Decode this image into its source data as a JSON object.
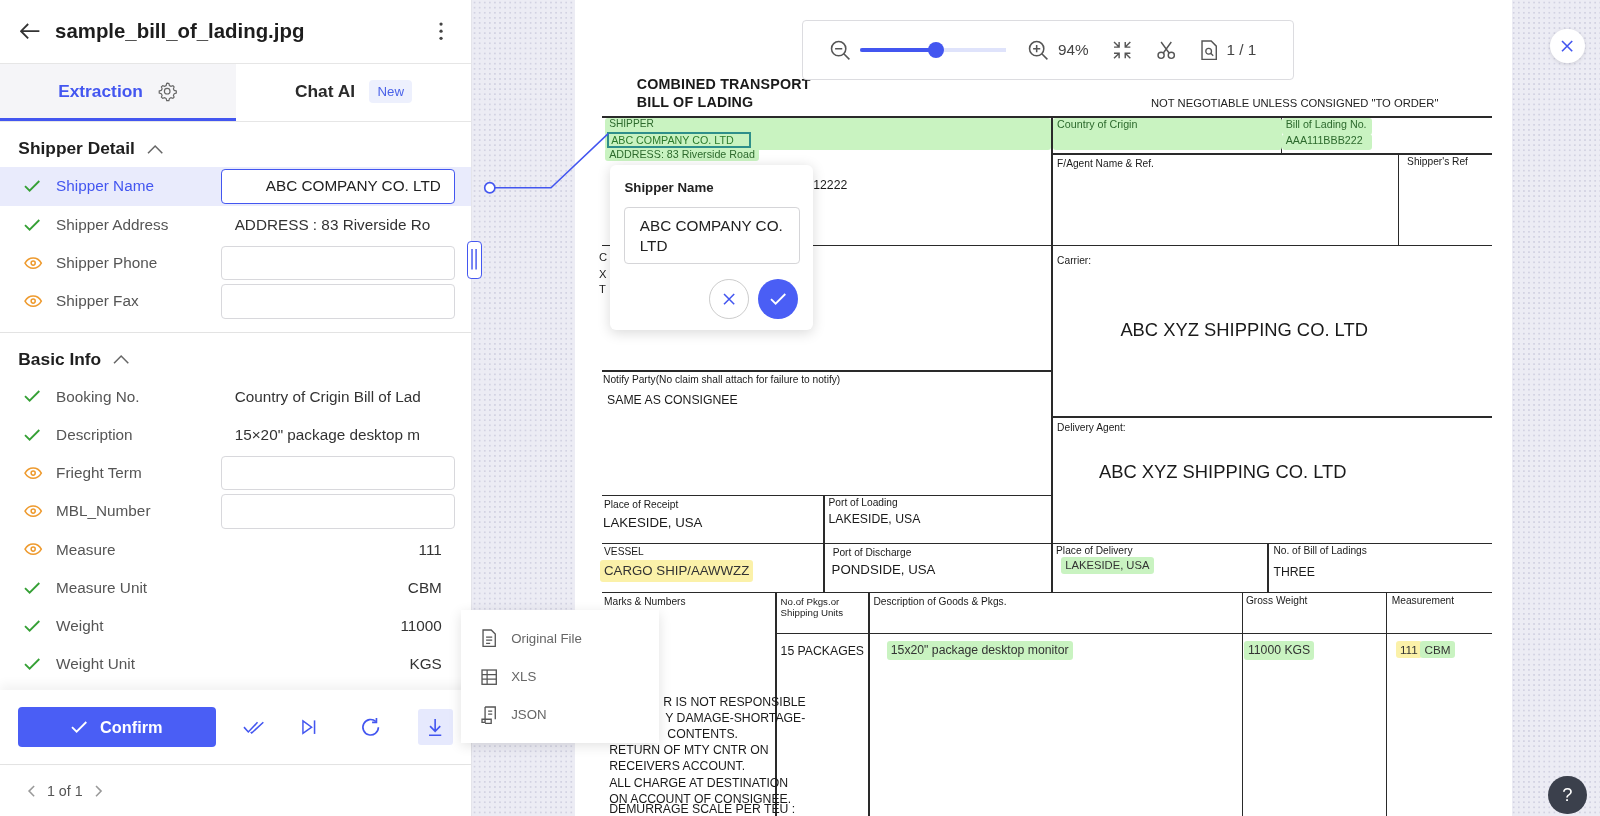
{
  "header": {
    "title": "sample_bill_of_lading.jpg"
  },
  "tabs": [
    {
      "label": "Extraction",
      "selected": true,
      "kind": "settings"
    },
    {
      "label": "Chat AI",
      "selected": false,
      "kind": "badge",
      "badge": "New"
    }
  ],
  "sections": [
    {
      "title": "Shipper Detail",
      "expanded": true,
      "fields": [
        {
          "label": "Shipper Name",
          "verified": true,
          "kind": "input",
          "value": "ABC COMPANY CO. LTD",
          "selected": true
        },
        {
          "label": "Shipper Address",
          "verified": true,
          "kind": "text",
          "value": "ADDRESS : 83 Riverside Ro",
          "selected": false
        },
        {
          "label": "Shipper Phone",
          "verified": false,
          "kind": "input",
          "selected": false
        },
        {
          "label": "Shipper Fax",
          "verified": false,
          "kind": "input",
          "selected": false
        }
      ]
    },
    {
      "title": "Basic Info",
      "expanded": true,
      "fields": [
        {
          "label": "Booking No.",
          "verified": true,
          "kind": "text",
          "value": "Country of Crigin Bill of Lad",
          "selected": false
        },
        {
          "label": "Description",
          "verified": true,
          "kind": "text",
          "value": "15×20\" package desktop m",
          "selected": false
        },
        {
          "label": "Frieght Term",
          "verified": false,
          "kind": "input",
          "selected": false
        },
        {
          "label": "MBL_Number",
          "verified": false,
          "kind": "input",
          "selected": false
        },
        {
          "label": "Measure",
          "verified": false,
          "kind": "number",
          "value": "111",
          "selected": false
        },
        {
          "label": "Measure Unit",
          "verified": true,
          "kind": "number",
          "value": "CBM",
          "selected": false
        },
        {
          "label": "Weight",
          "verified": true,
          "kind": "number",
          "value": "11000",
          "selected": false
        },
        {
          "label": "Weight Unit",
          "verified": true,
          "kind": "number",
          "value": "KGS",
          "selected": false
        }
      ]
    }
  ],
  "footer": {
    "confirm": "Confirm",
    "download_menu": {
      "open": true,
      "items": [
        {
          "label": "Original File",
          "kind": "file"
        },
        {
          "label": "XLS",
          "kind": "table"
        },
        {
          "label": "JSON",
          "kind": "code"
        }
      ]
    }
  },
  "pagination": {
    "text": "1 of 1"
  },
  "viewer_toolbar": {
    "zoom_slider": {
      "level": 0.52
    },
    "zoom": "94%",
    "page": "1 / 1"
  },
  "editor_popup": {
    "title": "Shipper Name",
    "value": "ABC COMPANY CO. LTD"
  },
  "help_button": {
    "label": "?"
  },
  "document": {
    "items": [
      {
        "kind": "title",
        "text": "COMBINED TRANSPORT"
      },
      {
        "kind": "title",
        "text": "BILL OF LADING"
      },
      {
        "kind": "notice",
        "text": "NOT NEGOTIABLE UNLESS CONSIGNED \"TO ORDER\""
      },
      {
        "kind": "label",
        "text": "SHIPPER",
        "color": "#c9f3c1"
      },
      {
        "kind": "focus",
        "text": "ABC COMPANY CO. LTD"
      },
      {
        "kind": "label",
        "text": "ADDRESS: 83 Riverside Road",
        "color": "#c9f3c1"
      },
      {
        "kind": "label",
        "text": "Country of Crigin",
        "color": "#c9f3c1"
      },
      {
        "kind": "label",
        "text": "Bill of Lading No.",
        "color": "#c9f3c1"
      },
      {
        "kind": "label",
        "text": "AAA111BBB222",
        "color": "#c9f3c1"
      },
      {
        "kind": "label",
        "text": "F/Agent Name & Ref."
      },
      {
        "kind": "label",
        "text": "Shipper's Ref"
      },
      {
        "kind": "value",
        "text": "12222"
      },
      {
        "kind": "value",
        "text": "C"
      },
      {
        "kind": "value",
        "text": "X"
      },
      {
        "kind": "value",
        "text": "T"
      },
      {
        "kind": "label",
        "text": "Carrier:"
      },
      {
        "kind": "large",
        "text": "ABC XYZ SHIPPING CO. LTD"
      },
      {
        "kind": "label",
        "text": "Notify Party(No claim shall attach for failure to notify)"
      },
      {
        "kind": "value",
        "text": "SAME AS CONSIGNEE"
      },
      {
        "kind": "label",
        "text": "Delivery Agent:"
      },
      {
        "kind": "large",
        "text": "ABC XYZ SHIPPING CO. LTD"
      },
      {
        "kind": "label",
        "text": "Place of Receipt"
      },
      {
        "kind": "value",
        "text": "LAKESIDE, USA"
      },
      {
        "kind": "label",
        "text": "Port of Loading"
      },
      {
        "kind": "value",
        "text": "LAKESIDE, USA"
      },
      {
        "kind": "label",
        "text": "VESSEL"
      },
      {
        "kind": "value",
        "text": "CARGO SHIP/AAWWZZ",
        "color": "#fbf1a9"
      },
      {
        "kind": "label",
        "text": "Port of Discharge"
      },
      {
        "kind": "value",
        "text": "PONDSIDE, USA"
      },
      {
        "kind": "label",
        "text": "Place of Delivery"
      },
      {
        "kind": "value",
        "text": "LAKESIDE, USA",
        "color": "#c9f3c1"
      },
      {
        "kind": "label",
        "text": "No. of Bill of Ladings"
      },
      {
        "kind": "value",
        "text": "THREE"
      },
      {
        "kind": "label",
        "text": "Marks & Numbers"
      },
      {
        "kind": "label",
        "text": "No.of Pkgs.or Shipping Units"
      },
      {
        "kind": "label",
        "text": "Description of Goods & Pkgs."
      },
      {
        "kind": "label",
        "text": "Gross Weight"
      },
      {
        "kind": "label",
        "text": "Measurement"
      },
      {
        "kind": "value",
        "text": "15 PACKAGES"
      },
      {
        "kind": "value",
        "text": "15x20\" package desktop monitor",
        "color": "#c9f3c1"
      },
      {
        "kind": "value",
        "text": "11000 KGS",
        "color": "#c9f3c1"
      },
      {
        "kind": "value",
        "text": "111",
        "color": "#fbf1a9"
      },
      {
        "kind": "value",
        "text": "CBM",
        "color": "#c9f3c1"
      },
      {
        "kind": "value",
        "text": "R IS NOT RESPONSIBLE"
      },
      {
        "kind": "value",
        "text": "Y DAMAGE-SHORTAGE-"
      },
      {
        "kind": "value",
        "text": "CONTENTS."
      },
      {
        "kind": "value",
        "text": "RETURN OF MTY CNTR ON"
      },
      {
        "kind": "value",
        "text": "RECEIVERS ACCOUNT."
      },
      {
        "kind": "value",
        "text": "ALL CHARGE AT DESTINATION"
      },
      {
        "kind": "value",
        "text": "ON ACCOUNT OF CONSIGNEE."
      },
      {
        "kind": "value",
        "text": "DEMURRAGE SCALE PER TEU :"
      }
    ]
  }
}
